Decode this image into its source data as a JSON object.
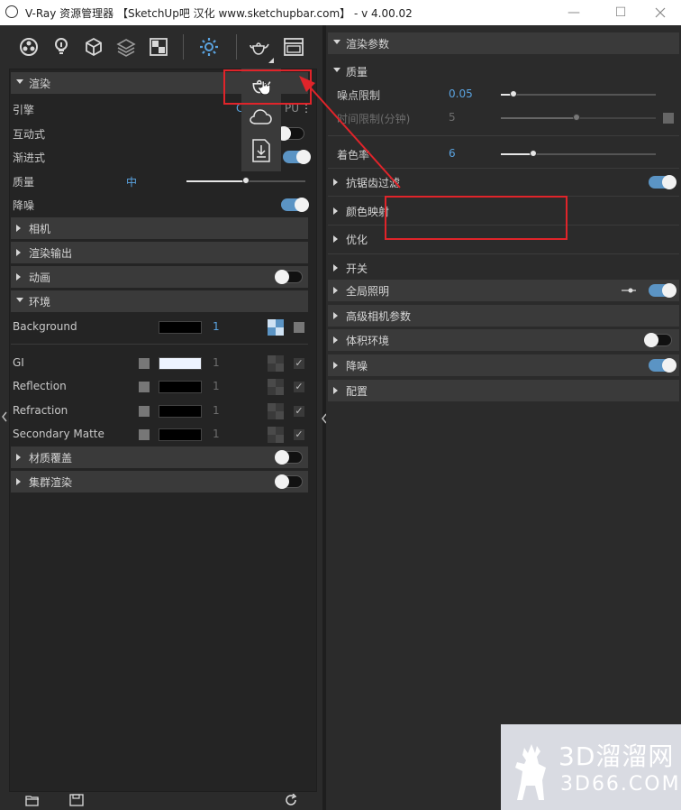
{
  "window": {
    "title": "V-Ray 资源管理器 【SketchUp吧 汉化 www.sketchupbar.com】 - v 4.00.02",
    "minimize": "—",
    "maximize": "☐"
  },
  "left": {
    "render_section": "渲染",
    "engine_label": "引擎",
    "engine_value_partial": "C",
    "engine_value_partial2": "PU",
    "interactive_label": "互动式",
    "progressive_label": "渐进式",
    "quality_label": "质量",
    "quality_value": "中",
    "denoise_label": "降噪",
    "camera_section": "相机",
    "render_output_section": "渲染输出",
    "animation_section": "动画",
    "environment_section": "环境",
    "background_label": "Background",
    "background_value": "1",
    "gi_label": "GI",
    "gi_value": "1",
    "reflection_label": "Reflection",
    "reflection_value": "1",
    "refraction_label": "Refraction",
    "refraction_value": "1",
    "secondary_label": "Secondary Matte",
    "secondary_value": "1",
    "material_override_section": "材质覆盖",
    "swarm_section": "集群渲染"
  },
  "right": {
    "render_params": "渲染参数",
    "quality_section": "质量",
    "noise_limit_label": "噪点限制",
    "noise_limit_value": "0.05",
    "time_limit_label": "时间限制(分钟)",
    "time_limit_value": "5",
    "shading_rate_label": "着色率",
    "shading_rate_value": "6",
    "antialias_section": "抗锯齿过滤",
    "color_mapping_section": "颜色映射",
    "optimize_section": "优化",
    "switches_section": "开关",
    "gi_section": "全局照明",
    "adv_camera_section": "高级相机参数",
    "volumetric_section": "体积环境",
    "denoise_section": "降噪",
    "config_section": "配置"
  },
  "watermark": {
    "line1": "3D溜溜网",
    "line2": "3D66.COM"
  },
  "colors": {
    "accent": "#5aa3e0",
    "toggle_on": "#5b94c4",
    "annotation_red": "#e0242a"
  }
}
